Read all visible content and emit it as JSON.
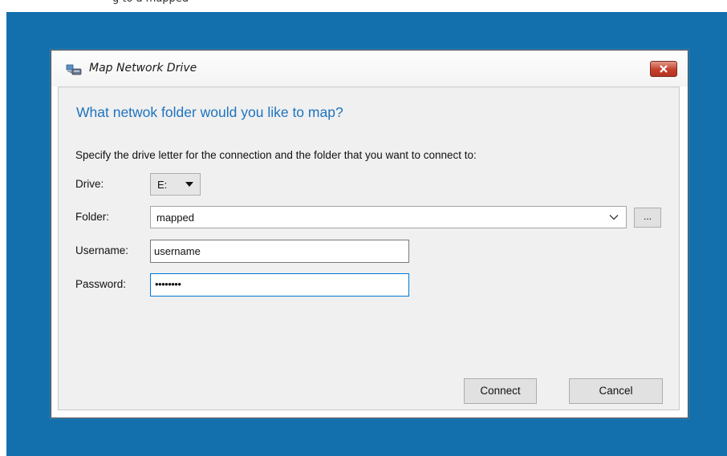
{
  "top_caption": "g to a mapped",
  "window": {
    "title": "Map Network Drive",
    "icons": {
      "app": "network-drive-icon",
      "close": "close-icon"
    }
  },
  "dialog": {
    "heading": "What netwok folder would you like to map?",
    "instruction": "Specify the drive letter for the connection and the folder that you want to connect to:",
    "drive": {
      "label": "Drive:",
      "value": "E:"
    },
    "folder": {
      "label": "Folder:",
      "value": "mapped",
      "browse_label": "..."
    },
    "username": {
      "label": "Username:",
      "value": "username"
    },
    "password": {
      "label": "Password:",
      "value": "••••••••"
    },
    "buttons": {
      "connect": "Connect",
      "cancel": "Cancel"
    }
  },
  "colors": {
    "desktop": "#1470ac",
    "heading": "#1e73be",
    "close_button": "#c4402c",
    "focus_border": "#0078d7"
  }
}
